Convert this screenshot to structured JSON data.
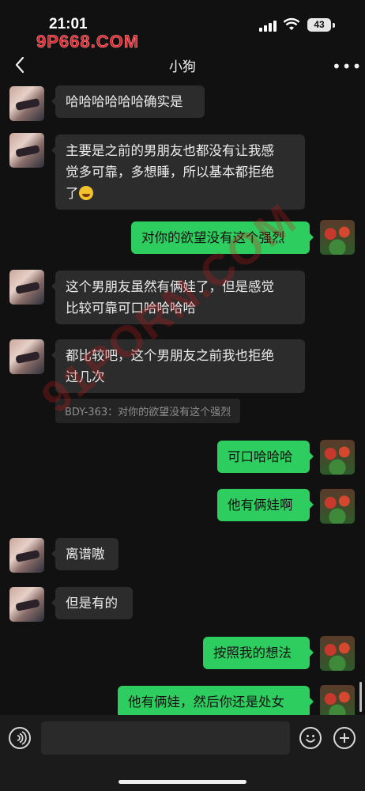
{
  "status": {
    "time": "21:01",
    "battery": "43"
  },
  "watermark_top": "9P668.COM",
  "watermark_mid": "91PORN.COM",
  "nav": {
    "title": "小狗",
    "more": "•••"
  },
  "messages": [
    {
      "side": "in",
      "text": "哈哈哈哈哈哈确实是"
    },
    {
      "side": "in",
      "line1": "主要是之前的男朋友也都没有让我感",
      "line2": "觉多可靠，多想睡，所以基本都拒绝",
      "line3": "了",
      "emoji": "face-with-tears-of-joy"
    },
    {
      "side": "out",
      "text": "对你的欲望没有这个强烈"
    },
    {
      "side": "in",
      "line1": "这个男朋友虽然有俩娃了，但是感觉",
      "line2": "比较可靠可口哈哈哈哈"
    },
    {
      "side": "in",
      "line1": "都比较吧，这个男朋友之前我也拒绝",
      "line2": "过几次",
      "quote": "BDY-363：对你的欲望没有这个强烈"
    },
    {
      "side": "out",
      "text": "可口哈哈哈"
    },
    {
      "side": "out",
      "text": "他有俩娃啊"
    },
    {
      "side": "in",
      "text": "离谱嗷"
    },
    {
      "side": "in",
      "text": "但是有的"
    },
    {
      "side": "out",
      "text": "按照我的想法"
    },
    {
      "side": "out",
      "text": "他有俩娃，然后你还是处女"
    }
  ],
  "input": {
    "placeholder": ""
  },
  "colors": {
    "background": "#111111",
    "bubble_in": "#2c2c2c",
    "bubble_out": "#2ecd5f"
  }
}
